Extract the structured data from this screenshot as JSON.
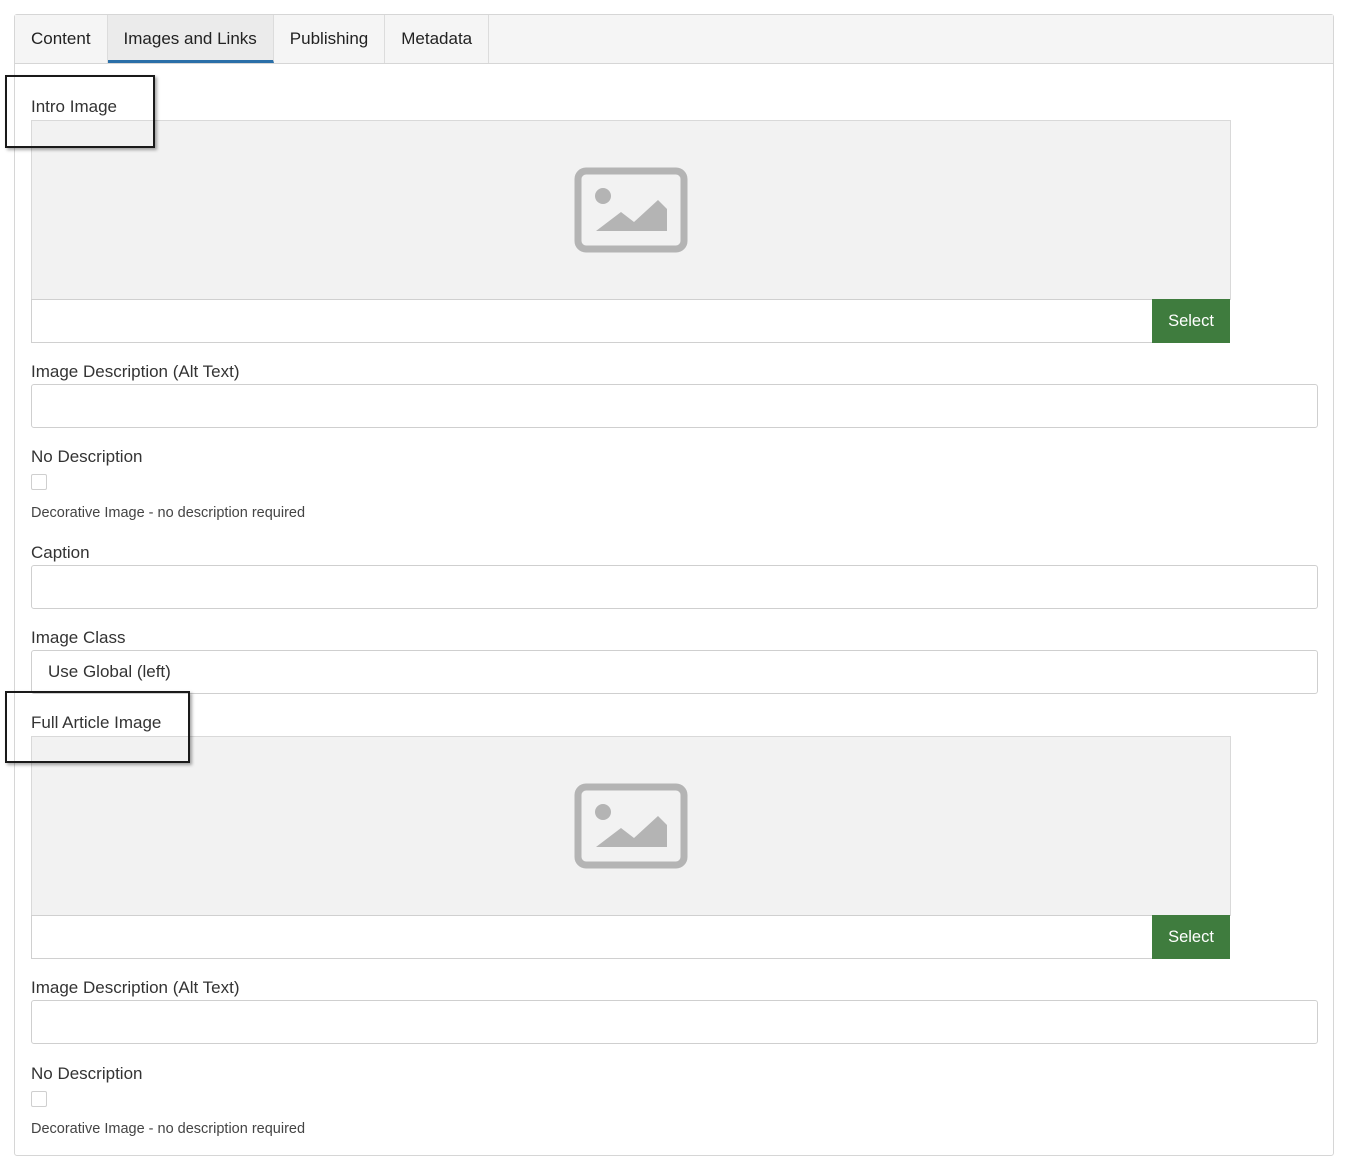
{
  "tabs": [
    {
      "label": "Content"
    },
    {
      "label": "Images and Links"
    },
    {
      "label": "Publishing"
    },
    {
      "label": "Metadata"
    }
  ],
  "active_tab": "Images and Links",
  "intro": {
    "title": "Intro Image",
    "select_label": "Select",
    "path_value": "",
    "alt_label": "Image Description (Alt Text)",
    "alt_value": "",
    "nodesc_label": "No Description",
    "nodesc_checked": false,
    "decorative_label": "Decorative Image - no description required",
    "caption_label": "Caption",
    "caption_value": "",
    "class_label": "Image Class",
    "class_value": "Use Global (left)"
  },
  "full": {
    "title": "Full Article Image",
    "select_label": "Select",
    "path_value": "",
    "alt_label": "Image Description (Alt Text)",
    "alt_value": "",
    "nodesc_label": "No Description",
    "nodesc_checked": false,
    "decorative_label": "Decorative Image - no description required"
  },
  "icons": {
    "placeholder": "image-placeholder-icon"
  },
  "colors": {
    "select_button": "#3f7c3e",
    "active_tab_underline": "#2a6fa8",
    "highlight_box": "#1a1a1a"
  }
}
